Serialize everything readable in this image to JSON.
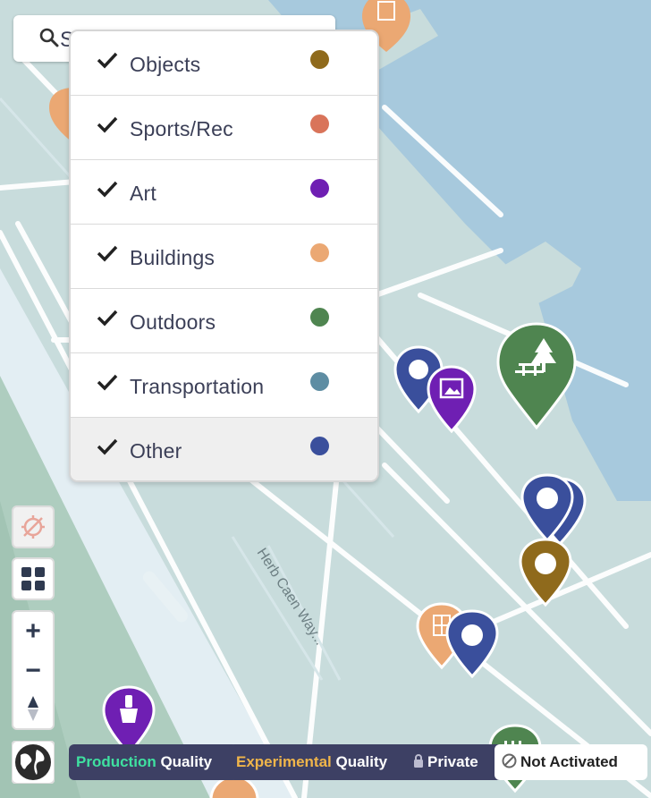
{
  "search": {
    "text": "S"
  },
  "filter_menu": {
    "items": [
      {
        "label": "Objects",
        "checked": true,
        "color": "#8f6a1c"
      },
      {
        "label": "Sports/Rec",
        "checked": true,
        "color": "#d9745a"
      },
      {
        "label": "Art",
        "checked": true,
        "color": "#6f1fb3"
      },
      {
        "label": "Buildings",
        "checked": true,
        "color": "#eba873"
      },
      {
        "label": "Outdoors",
        "checked": true,
        "color": "#4f8550"
      },
      {
        "label": "Transportation",
        "checked": true,
        "color": "#5e8da3"
      },
      {
        "label": "Other",
        "checked": true,
        "color": "#3a4f9c"
      }
    ]
  },
  "map": {
    "street_label": "Herb Caen Way..."
  },
  "controls": {
    "zoom_in": "+",
    "zoom_out": "−"
  },
  "legend": {
    "production_colored": "Production",
    "production_rest": " Quality",
    "experimental_colored": "Experimental",
    "experimental_rest": " Quality",
    "private": "Private",
    "not_activated": "Not Activated",
    "colors": {
      "production": "#3fe0a0",
      "experimental": "#f0b54a"
    }
  },
  "markers": [
    {
      "category": "Buildings",
      "icon": "building-icon"
    },
    {
      "category": "Buildings",
      "icon": "building-icon"
    },
    {
      "category": "Other",
      "icon": "circle-icon"
    },
    {
      "category": "Art",
      "icon": "picture-icon"
    },
    {
      "category": "Outdoors",
      "icon": "picnic-tree-icon"
    },
    {
      "category": "Other",
      "icon": "circle-icon"
    },
    {
      "category": "Other",
      "icon": "circle-icon"
    },
    {
      "category": "Objects",
      "icon": "circle-icon"
    },
    {
      "category": "Buildings",
      "icon": "building-icon"
    },
    {
      "category": "Other",
      "icon": "circle-icon"
    },
    {
      "category": "Art",
      "icon": "brush-icon"
    },
    {
      "category": "Outdoors",
      "icon": "fence-icon"
    },
    {
      "category": "Buildings",
      "icon": "building-icon"
    }
  ]
}
